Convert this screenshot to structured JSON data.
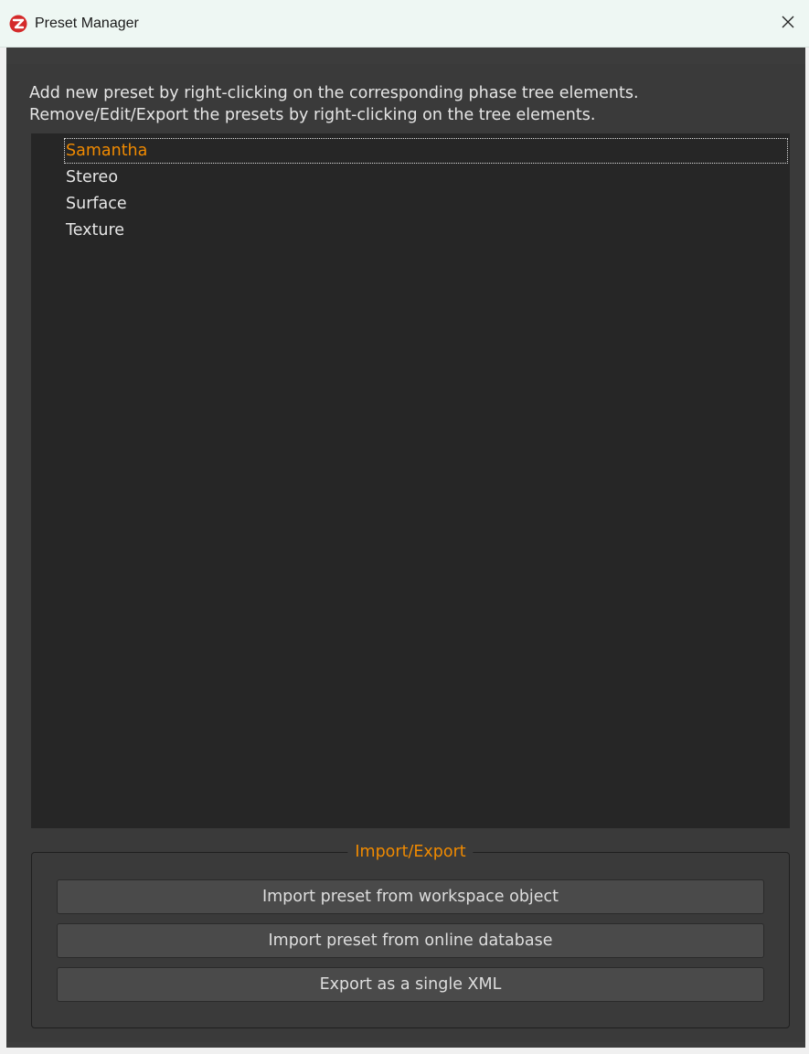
{
  "window": {
    "title": "Preset Manager",
    "app_icon": "app-logo-icon",
    "close_icon": "close-icon"
  },
  "instructions": {
    "line1": "Add new preset by right-clicking on the corresponding phase tree elements.",
    "line2": "Remove/Edit/Export the presets by right-clicking on the tree elements."
  },
  "tree": {
    "items": [
      {
        "label": "Samantha",
        "selected": true
      },
      {
        "label": "Stereo",
        "selected": false
      },
      {
        "label": "Surface",
        "selected": false
      },
      {
        "label": "Texture",
        "selected": false
      }
    ]
  },
  "import_export": {
    "title": "Import/Export",
    "buttons": {
      "workspace": "Import preset from workspace object",
      "online": "Import preset from online database",
      "export_xml": "Export as a single XML"
    }
  },
  "colors": {
    "accent": "#f08a00",
    "background": "#3a3a3a",
    "tree_background": "#262626",
    "text": "#e6e6e6"
  }
}
